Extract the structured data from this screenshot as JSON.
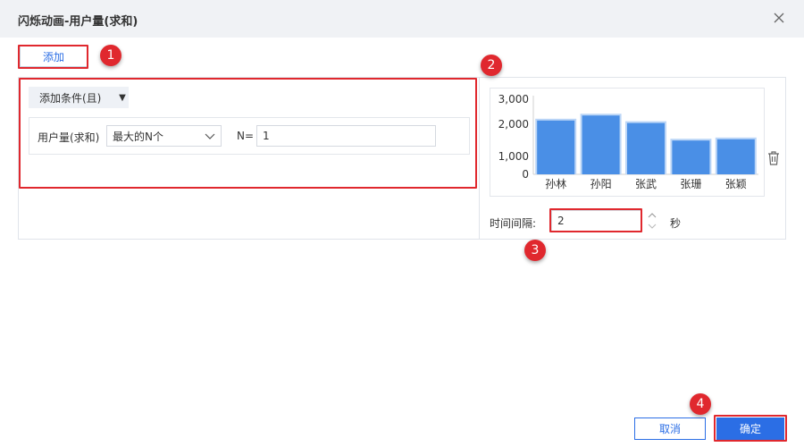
{
  "dialog": {
    "title": "闪烁动画-用户量(求和)"
  },
  "toolbar": {
    "add_label": "添加"
  },
  "condition": {
    "add_condition_label": "添加条件(且)",
    "field_label": "用户量(求和)",
    "select_value": "最大的N个",
    "n_label": "N=",
    "n_value": "1"
  },
  "chart_data": {
    "type": "bar",
    "categories": [
      "孙林",
      "孙阳",
      "张武",
      "张珊",
      "张颖"
    ],
    "values": [
      2150,
      2350,
      2050,
      1350,
      1400
    ],
    "ylim": [
      0,
      3000
    ],
    "yticks": [
      "3,000",
      "2,000",
      "1,000",
      "0"
    ],
    "bar_color": "#4a8fe6"
  },
  "interval": {
    "label": "时间间隔:",
    "value": "2",
    "unit": "秒"
  },
  "callouts": [
    "1",
    "2",
    "3",
    "4"
  ],
  "footer": {
    "cancel_label": "取消",
    "ok_label": "确定"
  },
  "colors": {
    "accent": "#2b6ee5",
    "highlight": "#e0282e"
  }
}
